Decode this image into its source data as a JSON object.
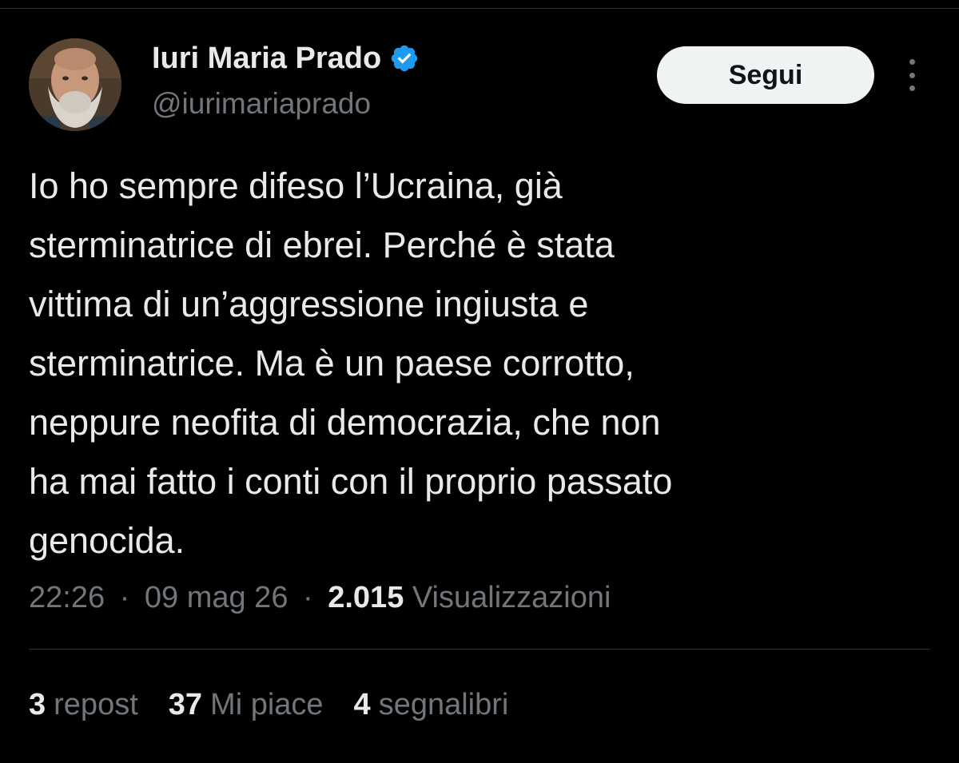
{
  "author": {
    "display_name": "Iuri Maria Prado",
    "handle": "@iurimariaprado",
    "verified_icon": "verified-badge-icon",
    "verified_color": "#1d9bf0"
  },
  "actions": {
    "follow_label": "Segui",
    "more_icon": "more-dots-vertical-icon"
  },
  "tweet": {
    "text": "Io ho sempre difeso l’Ucraina, già\nsterminatrice di ebrei. Perché è stata\nvittima di un’aggressione ingiusta e\nsterminatrice. Ma è un paese corrotto,\nneppure neofita di democrazia, che non\nha mai fatto i conti con il proprio passato\ngenocida."
  },
  "meta": {
    "time": "22:26",
    "date": "09 mag 26",
    "separator": "·",
    "views_count": "2.015",
    "views_label": "Visualizzazioni"
  },
  "stats": {
    "reposts_count": "3",
    "reposts_label": "repost",
    "likes_count": "37",
    "likes_label": "Mi piace",
    "bookmarks_count": "4",
    "bookmarks_label": "segnalibri"
  },
  "colors": {
    "background": "#000000",
    "text_primary": "#e7e9ea",
    "text_secondary": "#71767b",
    "divider": "#2f3336",
    "button_bg": "#eff3f4"
  }
}
